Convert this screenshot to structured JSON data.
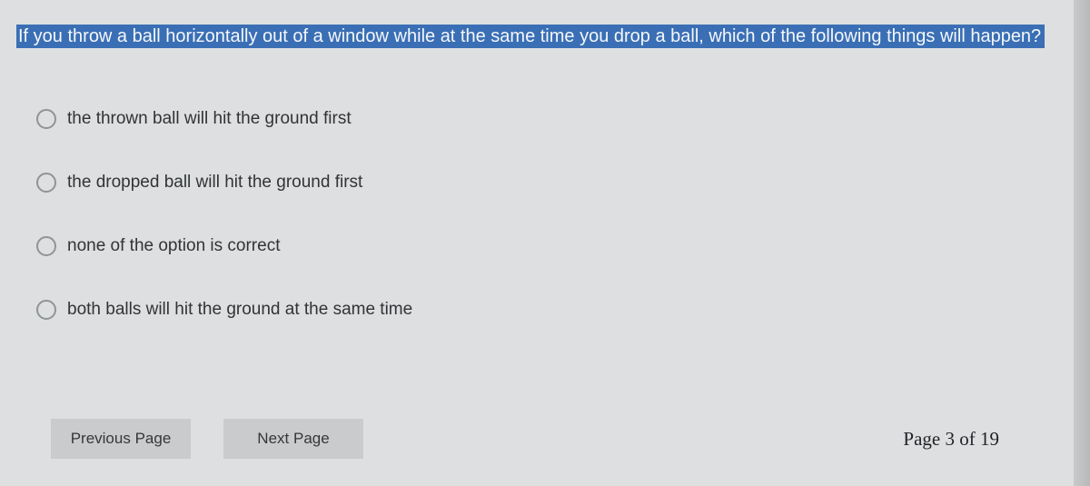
{
  "question": {
    "text": "If you throw a ball horizontally out of a window while at the same time you drop a ball, which of the following things will happen?"
  },
  "options": [
    {
      "label": "the thrown ball will hit the ground first"
    },
    {
      "label": "the dropped ball will hit the ground first"
    },
    {
      "label": "none of the option is correct"
    },
    {
      "label": "both balls will hit the ground at the same time"
    }
  ],
  "footer": {
    "prev_label": "Previous Page",
    "next_label": "Next Page",
    "page_indicator": "Page 3 of 19"
  }
}
